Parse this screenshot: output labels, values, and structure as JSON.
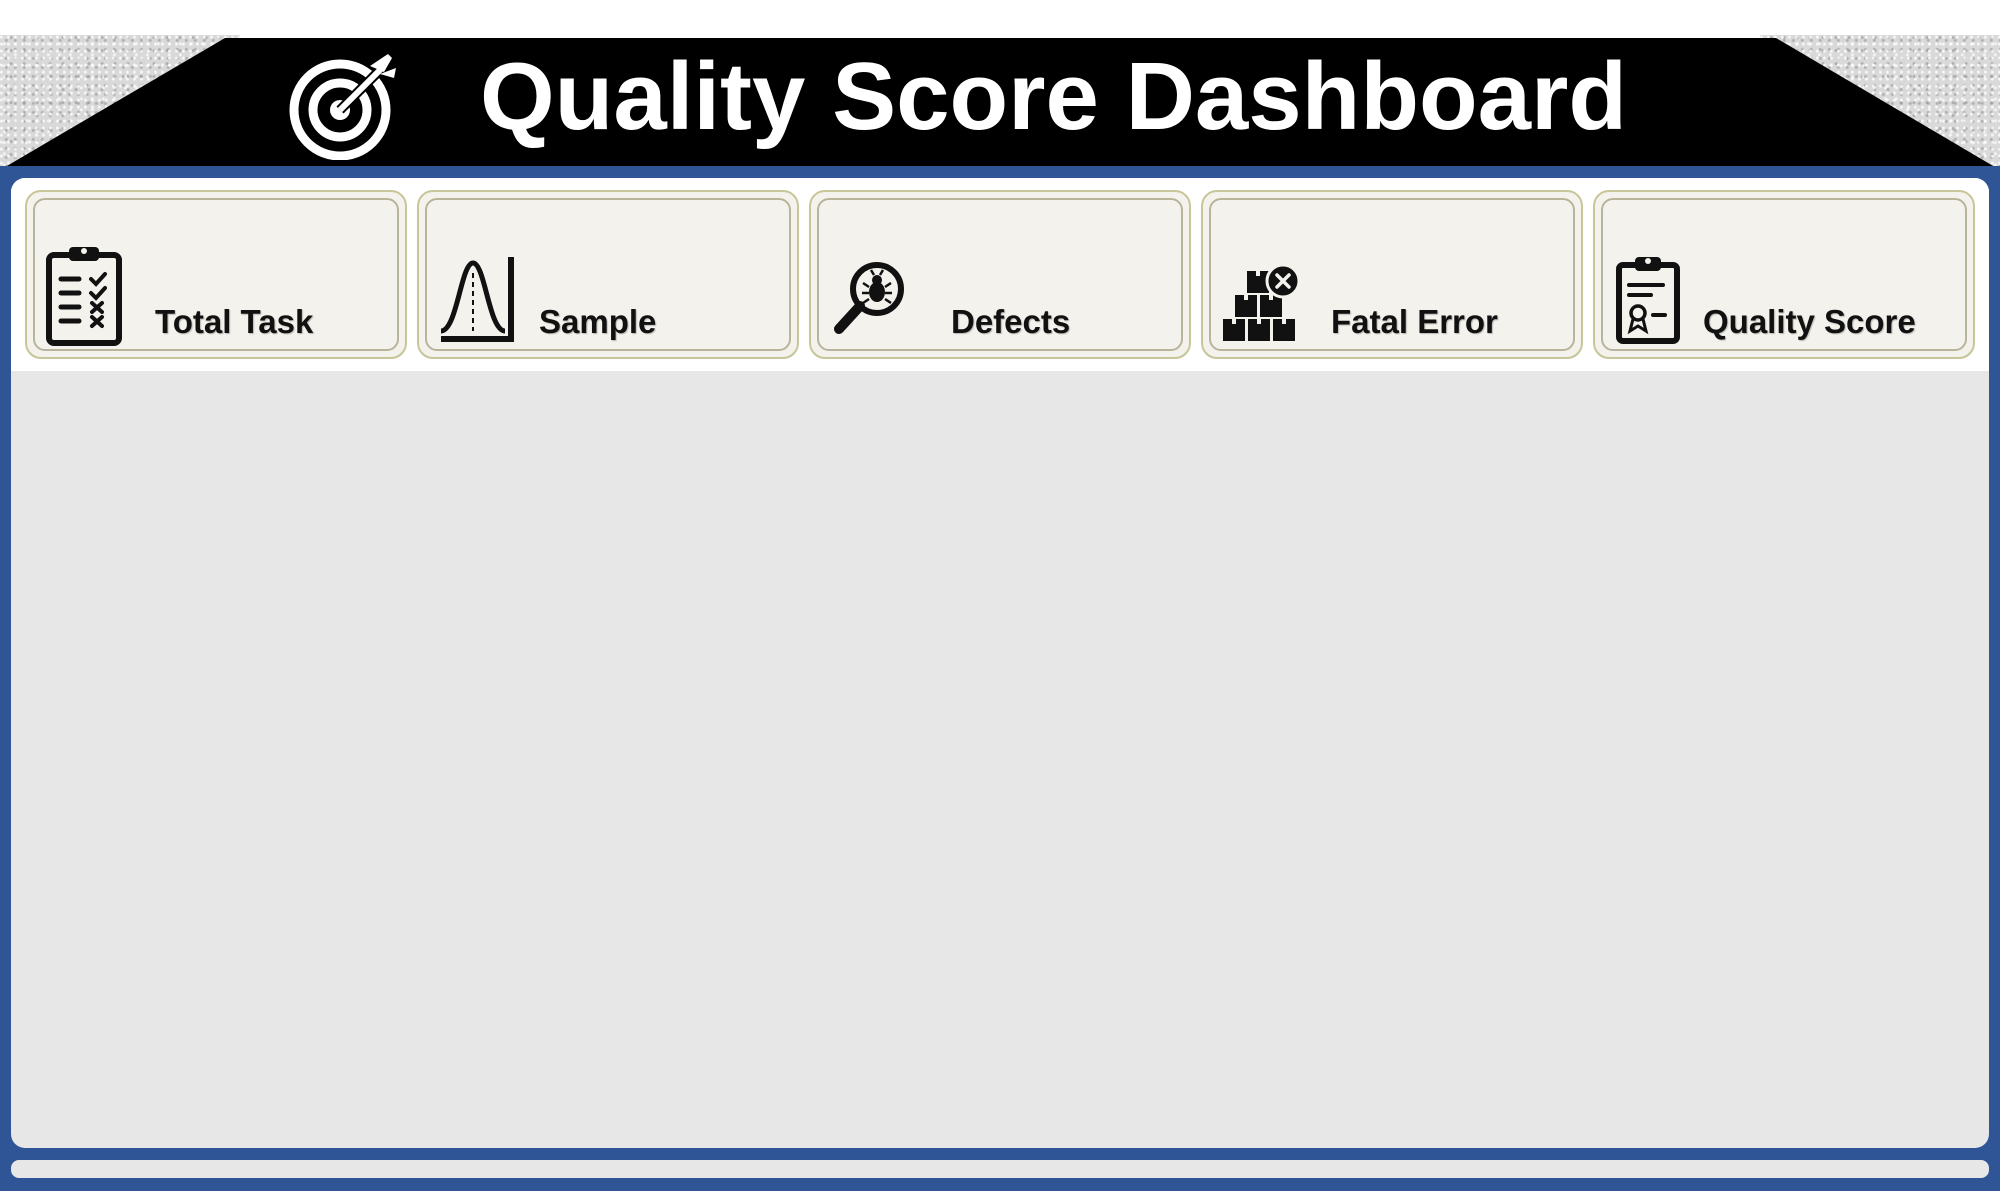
{
  "header": {
    "title": "Quality Score Dashboard",
    "icon": "target-arrow-icon"
  },
  "colors": {
    "header_bg": "#000000",
    "frame": "#2f5597",
    "panel": "#e7e7e7",
    "card_bg": "#f4f2ec",
    "card_border": "#c9c59a"
  },
  "kpi_cards": [
    {
      "label": "Total Task",
      "icon": "clipboard-checklist-icon"
    },
    {
      "label": "Sample",
      "icon": "bell-curve-icon"
    },
    {
      "label": "Defects",
      "icon": "magnifier-bug-icon"
    },
    {
      "label": "Fatal Error",
      "icon": "boxes-error-icon"
    },
    {
      "label": "Quality Score",
      "icon": "clipboard-certificate-icon"
    }
  ]
}
